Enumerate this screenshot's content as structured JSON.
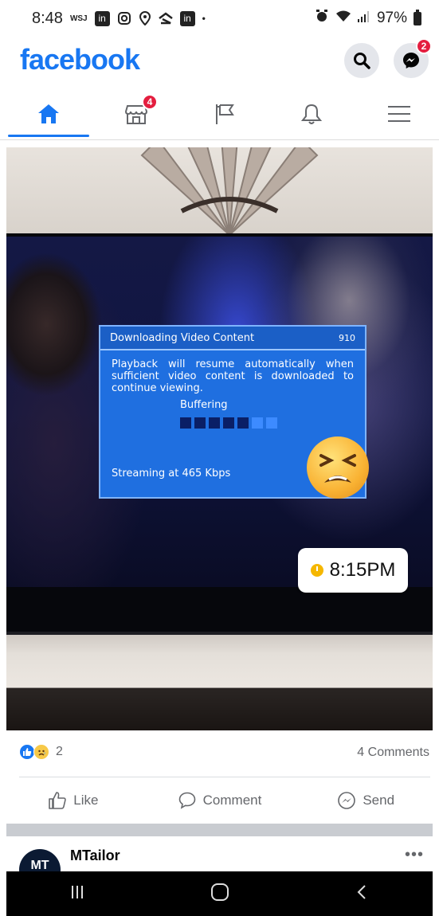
{
  "status_bar": {
    "time": "8:48",
    "wsj": "WSJ",
    "battery": "97%"
  },
  "header": {
    "logo": "facebook",
    "messenger_badge": "2"
  },
  "nav": {
    "marketplace_badge": "4",
    "active_tab": "home"
  },
  "post": {
    "dialog_title": "Downloading Video Content",
    "dialog_code": "910",
    "dialog_message": "Playback will resume automatically when sufficient video content is downloaded to continue viewing.",
    "buffering_label": "Buffering",
    "buffer_progress": {
      "filled": 5,
      "total": 7
    },
    "streaming_text": "Streaming at 465 Kbps",
    "time_overlay": "8:15PM",
    "reaction_count": "2",
    "comments": "4 Comments",
    "actions": {
      "like": "Like",
      "comment": "Comment",
      "send": "Send"
    }
  },
  "next_post": {
    "avatar_initials": "MT",
    "name": "MTailor",
    "more": "•••"
  },
  "colors": {
    "brand": "#1877f2",
    "badge": "#e41e3f",
    "dialog": "#1f6fe0"
  },
  "icons": [
    "home-icon",
    "marketplace-icon",
    "pages-flag-icon",
    "notifications-bell-icon",
    "menu-icon",
    "search-icon",
    "messenger-icon",
    "like-icon",
    "comment-icon",
    "send-icon"
  ]
}
